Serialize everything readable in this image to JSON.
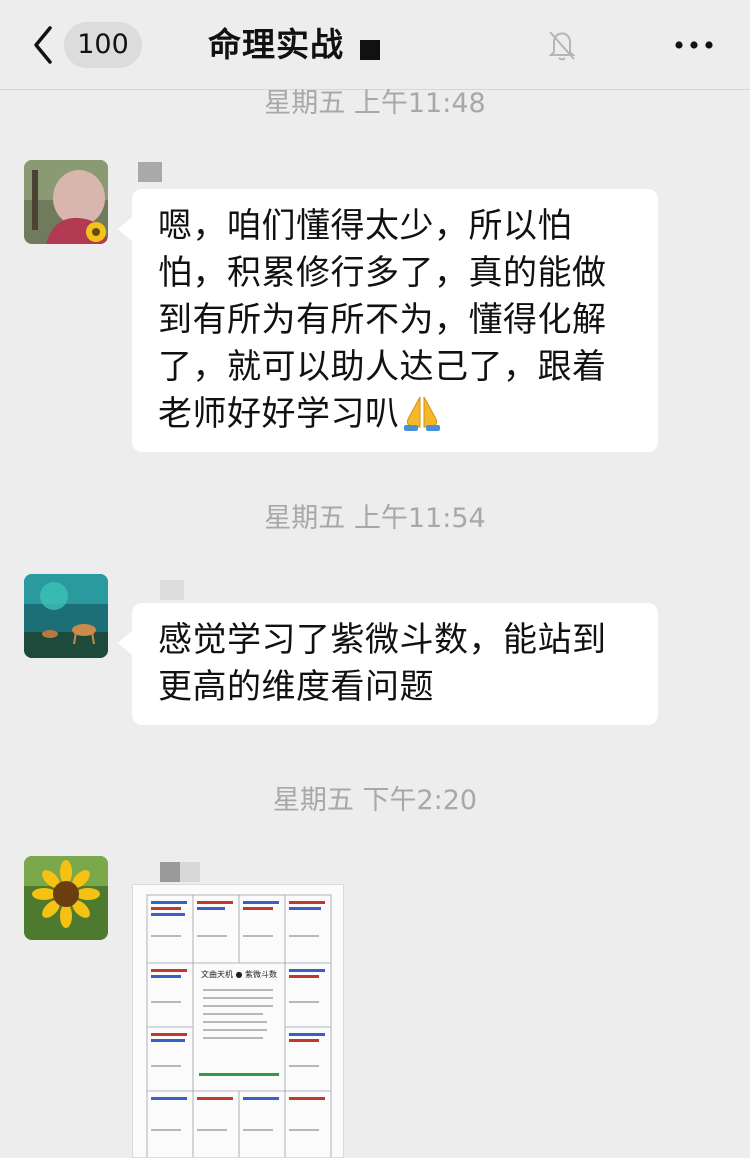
{
  "header": {
    "unread_count": "100",
    "title": "命理实战"
  },
  "timestamps": [
    "星期五 上午11:48",
    "星期五 上午11:54",
    "星期五 下午2:20"
  ],
  "messages": [
    {
      "text": "嗯，咱们懂得太少，所以怕怕，积累修行多了，真的能做到有所为有所不为，懂得化解了，就可以助人达己了，跟着老师好好学习叭",
      "emoji": "pray-emoji"
    },
    {
      "text": "感觉学习了紫微斗数，能站到更高的维度看问题"
    },
    {
      "type": "image",
      "image_title": "文曲天机 ● 紫微斗数"
    }
  ]
}
